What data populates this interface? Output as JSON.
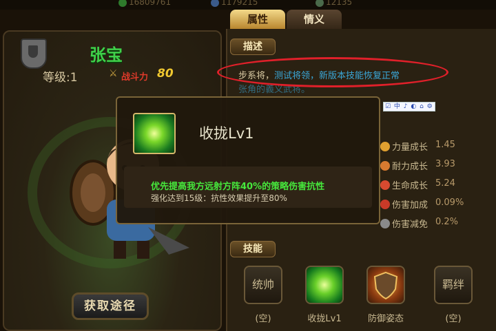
{
  "topbar": {
    "resources": [
      {
        "value": "16809761",
        "icon": "coin-icon"
      },
      {
        "value": "1179215",
        "icon": "gem-icon"
      },
      {
        "value": "12135",
        "icon": "stamina-icon"
      }
    ]
  },
  "tabs": [
    {
      "label": "属性",
      "active": true
    },
    {
      "label": "情义",
      "active": false
    }
  ],
  "hero": {
    "name": "张宝",
    "level": "等级:1",
    "power_label": "战斗力",
    "power_value": "80",
    "get_button": "获取途径"
  },
  "description": {
    "header": "描述",
    "line1_prefix": "步系将，",
    "line1_highlight": "测试将领，新版本技能恢复正常",
    "line2": "张角的義义武将。"
  },
  "overlay_strip": "☑ 中 ♪ ◐ ⌂ ⚙",
  "stats": [
    {
      "label": "力量成长",
      "value": "1.45",
      "color": "#e0a030"
    },
    {
      "label": "耐力成长",
      "value": "3.93",
      "color": "#d87a30"
    },
    {
      "label": "生命成长",
      "value": "5.24",
      "color": "#d84a30"
    },
    {
      "label": "伤害加成",
      "value": "0.09%",
      "color": "#c83a28"
    },
    {
      "label": "伤害减免",
      "value": "0.2%",
      "color": "#8a8a8a"
    }
  ],
  "skills": {
    "header": "技能",
    "slots": [
      {
        "icon_text": "统帅",
        "label": "(空)",
        "kind": "empty"
      },
      {
        "icon_text": "",
        "label": "收拢Lv1",
        "kind": "skill"
      },
      {
        "icon_text": "",
        "label": "防御姿态",
        "kind": "shield"
      },
      {
        "icon_text": "羁绊",
        "label": "(空)",
        "kind": "empty"
      }
    ]
  },
  "popup": {
    "title": "收拢Lv1",
    "effect": "优先提高我方远射方阵40%的策略伤害抗性",
    "upgrade": "强化达到15级：抗性效果提升至80%"
  }
}
